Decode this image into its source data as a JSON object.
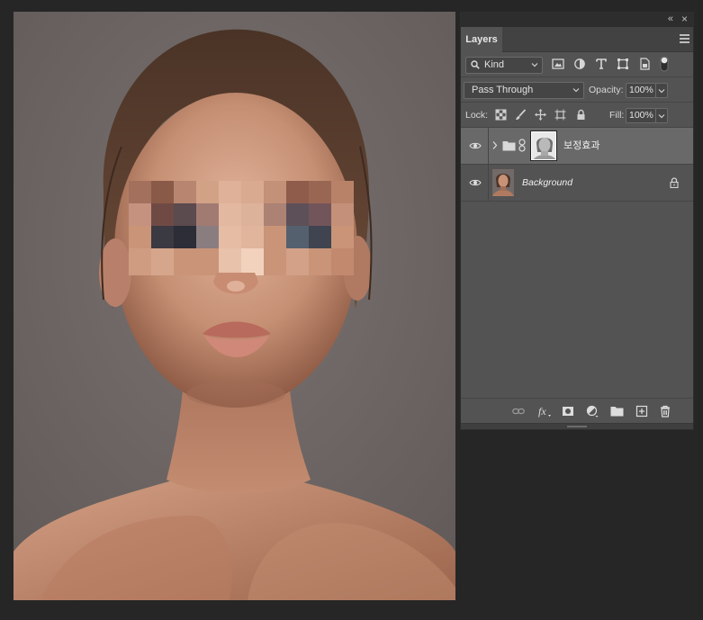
{
  "canvas": {
    "image": "portrait-photo-with-pixelated-eyes"
  },
  "panel": {
    "collapse_icon": "double-chevron-left-icon",
    "close_icon": "close-icon",
    "tab_label": "Layers",
    "menu_icon": "panel-menu-icon"
  },
  "filter": {
    "kind_label": "Kind",
    "icons": [
      "image-filter-icon",
      "adjustment-filter-icon",
      "type-filter-icon",
      "shape-filter-icon",
      "smart-object-filter-icon",
      "filter-toggle-icon"
    ]
  },
  "blend": {
    "mode": "Pass Through",
    "opacity_label": "Opacity:",
    "opacity_value": "100%"
  },
  "lock": {
    "label": "Lock:",
    "icons": [
      "lock-transparent-icon",
      "lock-paint-icon",
      "lock-position-icon",
      "lock-artboard-icon",
      "lock-all-icon"
    ],
    "fill_label": "Fill:",
    "fill_value": "100%"
  },
  "layers": [
    {
      "name": "보정효과",
      "type": "group",
      "visible": true,
      "selected": true
    },
    {
      "name": "Background",
      "type": "background",
      "visible": true,
      "selected": false,
      "locked": true
    }
  ],
  "footer": {
    "icons": [
      "link-layers-icon",
      "fx-icon",
      "add-mask-icon",
      "new-adjustment-icon",
      "new-group-icon",
      "new-layer-icon",
      "trash-icon"
    ]
  },
  "colors": {
    "workspace": "#262626",
    "panel": "#535353",
    "selected_row": "#696969",
    "tab_bar": "#424242"
  }
}
